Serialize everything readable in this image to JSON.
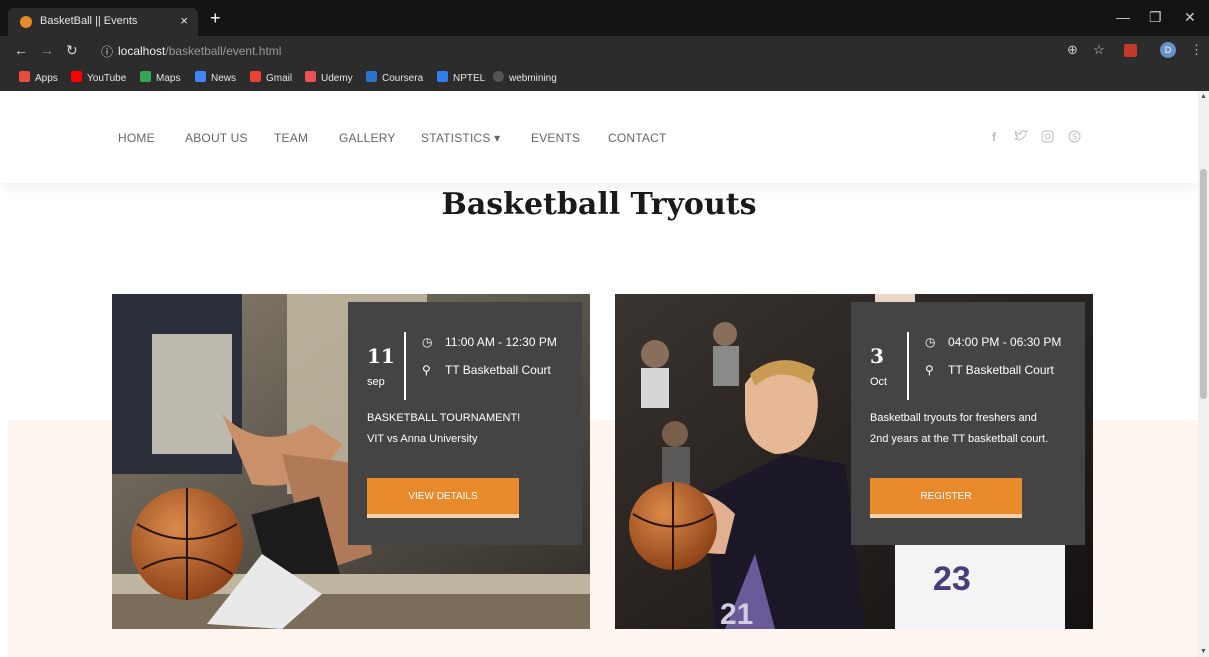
{
  "browser": {
    "tab_title": "BasketBall || Events",
    "tab_close": "×",
    "new_tab": "+",
    "url_host": "localhost",
    "url_path": "/basketball/event.html",
    "profile_initial": "D",
    "bookmarks": [
      {
        "label": "Apps",
        "color": "#e94b3c"
      },
      {
        "label": "YouTube",
        "color": "#ff0000"
      },
      {
        "label": "Maps",
        "color": "#34a853"
      },
      {
        "label": "News",
        "color": "#4285f4"
      },
      {
        "label": "Gmail",
        "color": "#ea4335"
      },
      {
        "label": "Udemy",
        "color": "#ec5252"
      },
      {
        "label": "Coursera",
        "color": "#2a73cc"
      },
      {
        "label": "NPTEL",
        "color": "#2f80ed"
      },
      {
        "label": "webmining",
        "color": "#555555"
      }
    ]
  },
  "nav": {
    "items": [
      "HOME",
      "ABOUT US",
      "TEAM",
      "GALLERY",
      "STATISTICS ▾",
      "EVENTS",
      "CONTACT"
    ],
    "social_icons": [
      "facebook-icon",
      "twitter-icon",
      "instagram-icon",
      "skype-icon"
    ]
  },
  "page": {
    "title": "Basketball Tryouts"
  },
  "events": [
    {
      "day": "11",
      "month": "sep",
      "time": "11:00 AM - 12:30 PM",
      "location": "TT Basketball Court",
      "desc_line1": "BASKETBALL TOURNAMENT!",
      "desc_line2": "VIT vs Anna University",
      "button": "VIEW DETAILS"
    },
    {
      "day": "3",
      "month": "Oct",
      "time": "04:00 PM - 06:30 PM",
      "location": "TT Basketball Court",
      "desc_line1": "Basketball tryouts for freshers and",
      "desc_line2": "2nd years at the TT basketball court.",
      "button": "REGISTER"
    }
  ],
  "colors": {
    "accent": "#e8892b",
    "info_box": "#444444",
    "peach_band": "#fdf5ef"
  }
}
